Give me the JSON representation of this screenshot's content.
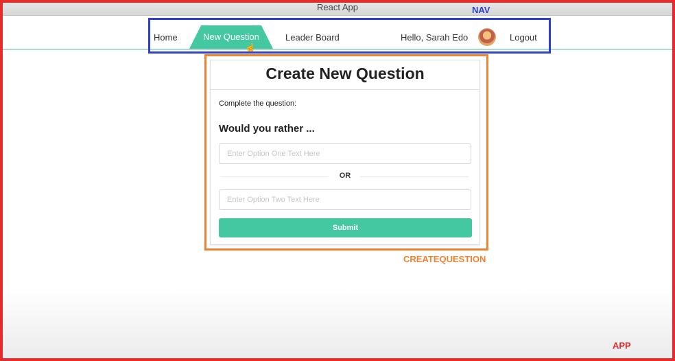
{
  "window": {
    "title": "React App"
  },
  "nav": {
    "home_label": "Home",
    "new_question_label": "New Question",
    "leader_board_label": "Leader Board",
    "greeting": "Hello, Sarah Edo",
    "avatar_icon": "user-avatar-icon",
    "logout_label": "Logout",
    "active_tab": "New Question",
    "accent_color": "#43c8a1"
  },
  "create_question": {
    "title": "Create New Question",
    "subtitle": "Complete the question:",
    "prompt": "Would you rather ...",
    "option_one": {
      "placeholder": "Enter Option One Text Here",
      "value": ""
    },
    "or_label": "OR",
    "option_two": {
      "placeholder": "Enter Option Two Text Here",
      "value": ""
    },
    "submit_label": "Submit",
    "button_color": "#43c8a1"
  },
  "annotations": {
    "nav_tag": "NAV",
    "nav_color": "#2e3fd0",
    "create_question_tag": "CREATEQUESTION",
    "create_question_color": "#f28130",
    "app_tag": "APP",
    "app_color": "#e52b2b"
  }
}
